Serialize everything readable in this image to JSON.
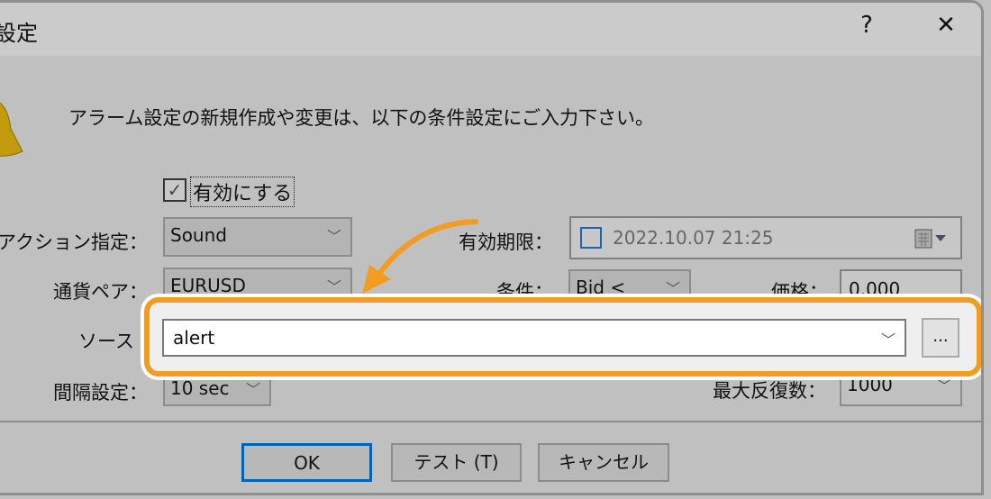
{
  "window": {
    "title": "設定",
    "help_label": "?",
    "close_label": "✕"
  },
  "description": "アラーム設定の新規作成や変更は、以下の条件設定にご入力下さい。",
  "enable": {
    "label": "有効にする",
    "checked": true
  },
  "action": {
    "label": "アクション指定：",
    "value": "Sound"
  },
  "expiry": {
    "label": "有効期限：",
    "value": "2022.10.07 21:25",
    "checked": false
  },
  "symbol": {
    "label": "通貨ペア：",
    "value": "EURUSD"
  },
  "condition": {
    "label": "条件：",
    "value": "Bid <"
  },
  "price": {
    "label": "価格：",
    "value": "0.000"
  },
  "source": {
    "label": "ソース",
    "value": "alert",
    "browse_label": "..."
  },
  "interval": {
    "label": "間隔設定：",
    "value": "10 sec"
  },
  "max_repeat": {
    "label": "最大反復数：",
    "value": "1000"
  },
  "buttons": {
    "ok": "OK",
    "test": "テスト (T)",
    "cancel": "キャンセル"
  },
  "colors": {
    "highlight": "#f39c22",
    "focus": "#0063b1"
  },
  "icons": {
    "bell": "bell-icon",
    "calendar": "calendar-icon"
  }
}
